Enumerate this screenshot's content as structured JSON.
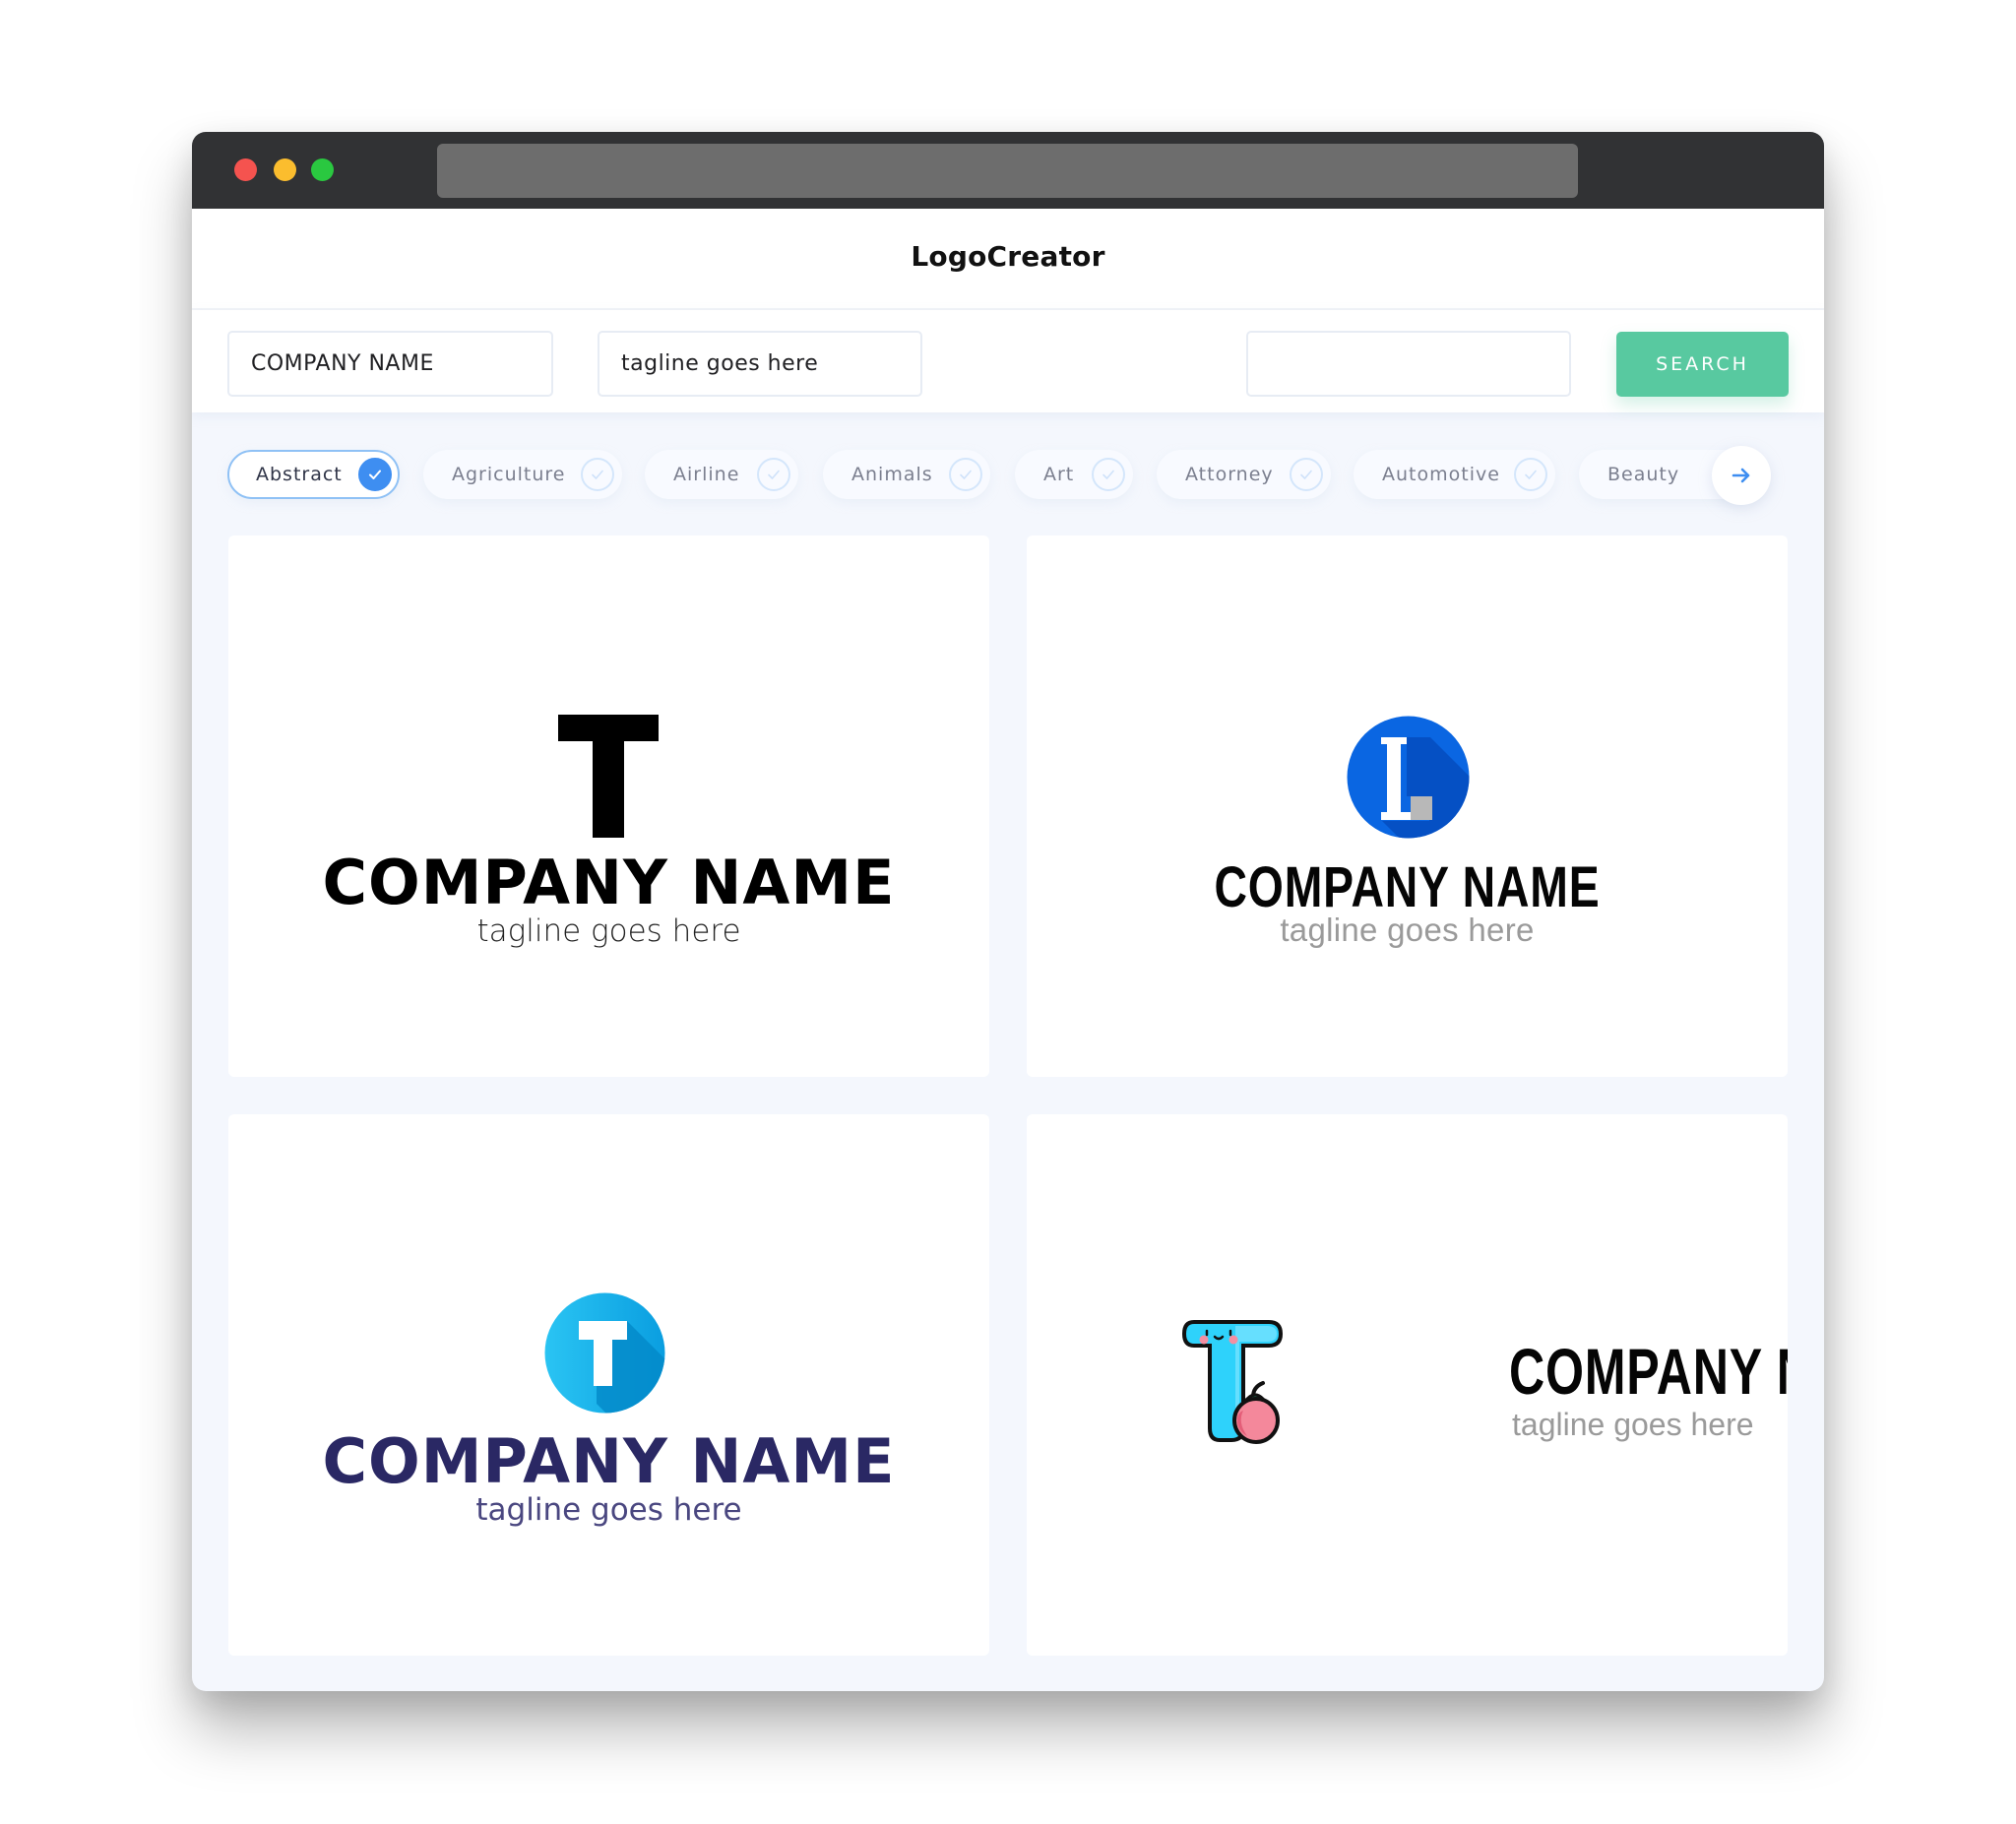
{
  "browser": {
    "traffic_lights": [
      "close",
      "minimize",
      "maximize"
    ],
    "colors": {
      "close": "#f5534f",
      "minimize": "#fbbd2e",
      "maximize": "#2ac840"
    }
  },
  "header": {
    "brand": "LogoCreator"
  },
  "search": {
    "company_name_value": "COMPANY NAME",
    "tagline_value": "tagline goes here",
    "keyword_value": "",
    "button_label": "SEARCH",
    "button_color": "#58c9a0"
  },
  "categories": {
    "items": [
      {
        "label": "Abstract",
        "selected": true
      },
      {
        "label": "Agriculture",
        "selected": false
      },
      {
        "label": "Airline",
        "selected": false
      },
      {
        "label": "Animals",
        "selected": false
      },
      {
        "label": "Art",
        "selected": false
      },
      {
        "label": "Attorney",
        "selected": false
      },
      {
        "label": "Automotive",
        "selected": false
      },
      {
        "label": "Beauty",
        "selected": false
      }
    ],
    "next_icon": "arrow-right-icon",
    "accent_color": "#3e8ef1"
  },
  "logos": [
    {
      "mark": "T",
      "mark_style": "bold-black-letter",
      "company_name": "COMPANY NAME",
      "tagline": "tagline goes here",
      "name_color": "#000000"
    },
    {
      "mark": "L",
      "mark_style": "white-letter-in-blue-circle",
      "company_name": "COMPANY NAME",
      "tagline": "tagline goes here",
      "circle_color": "#0a66e2",
      "name_color": "#050505"
    },
    {
      "mark": "T",
      "mark_style": "white-letter-in-cyan-gradient-circle",
      "company_name": "COMPANY NAME",
      "tagline": "tagline goes here",
      "circle_color": "#1ab7ee",
      "name_color": "#2a2864"
    },
    {
      "mark": "T",
      "mark_style": "cute-cyan-letter-with-apple",
      "company_name": "COMPANY NAME",
      "tagline": "tagline goes here",
      "name_color": "#050505"
    }
  ]
}
